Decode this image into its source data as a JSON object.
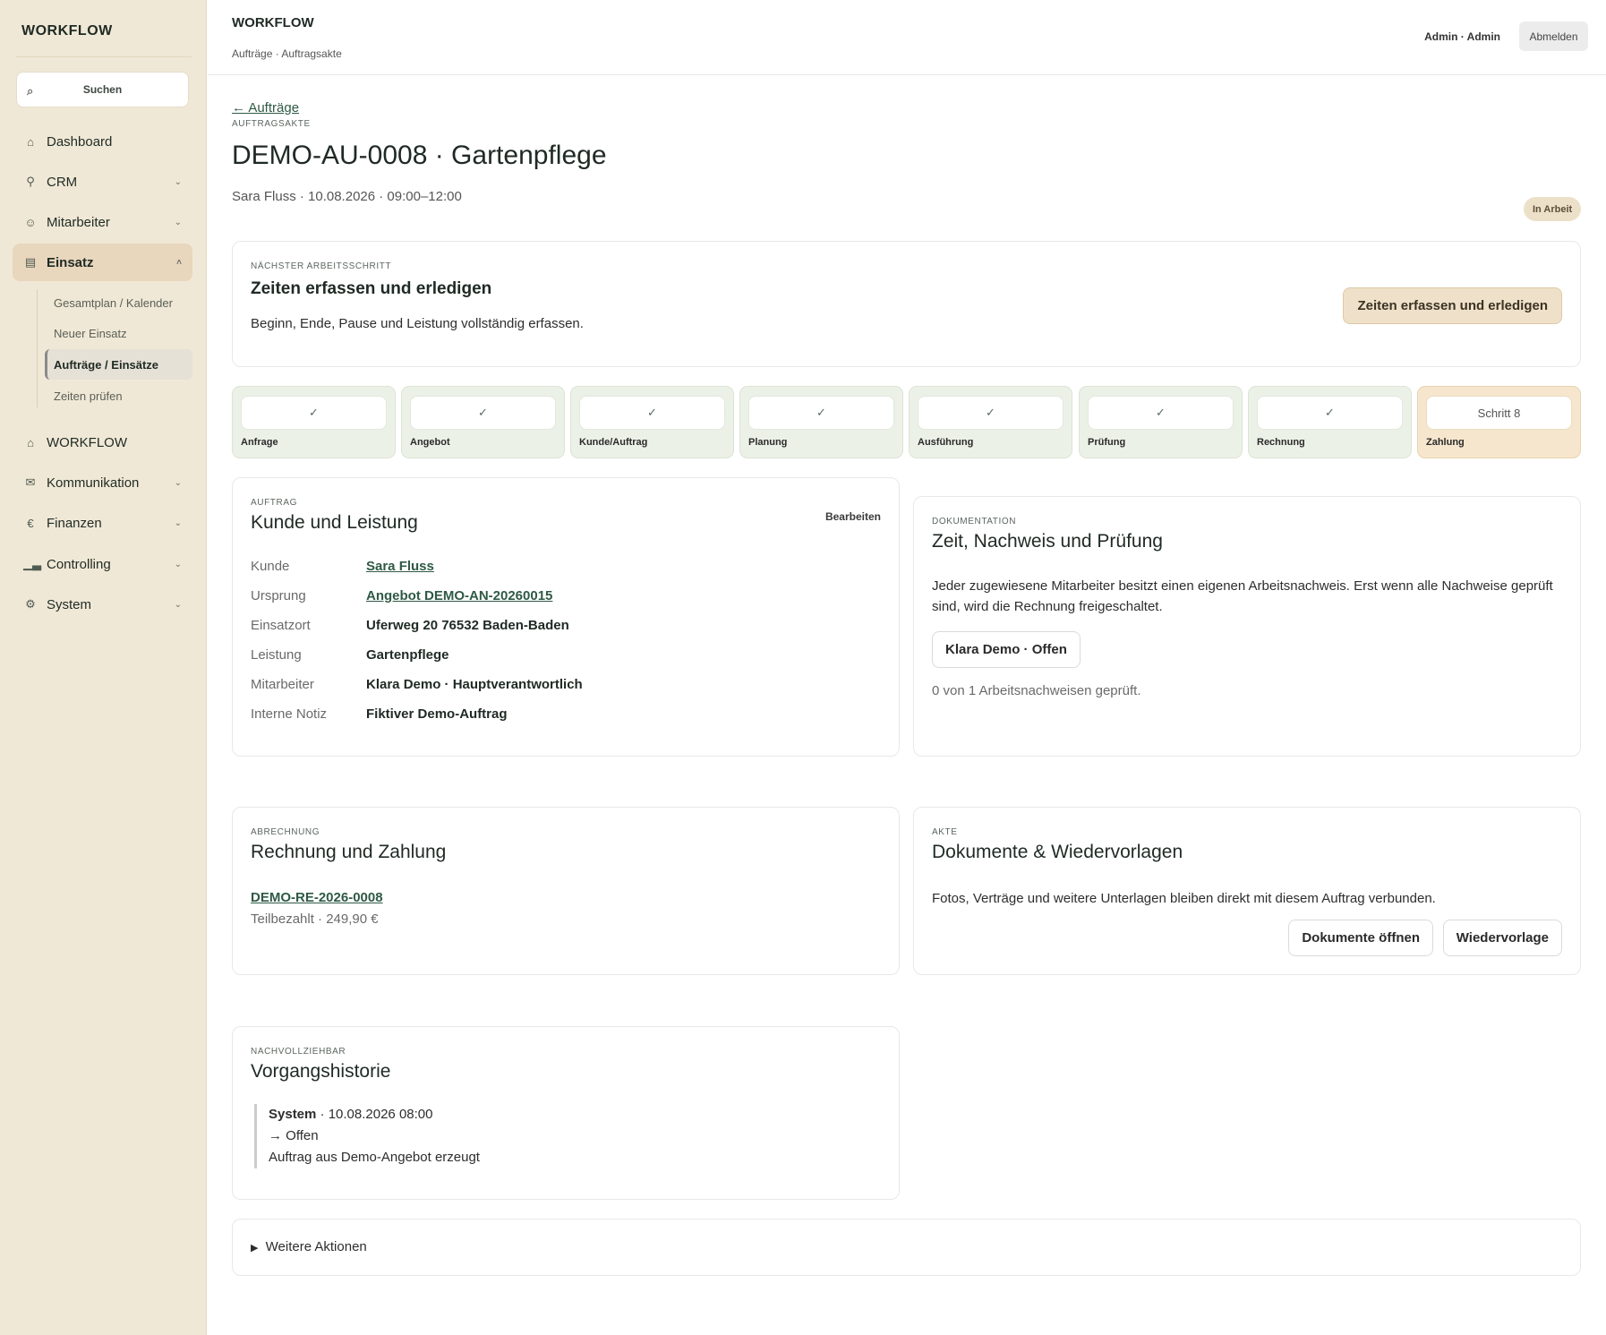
{
  "sidebar": {
    "brand": "WORKFLOW",
    "search_label": "Suchen",
    "search_icon": "⌕",
    "nav": [
      {
        "label": "Dashboard",
        "icon": "home-icon",
        "chevron": ""
      },
      {
        "label": "CRM",
        "icon": "users-icon",
        "chevron": "⌄"
      },
      {
        "label": "Mitarbeiter",
        "icon": "person-icon",
        "chevron": "⌄"
      },
      {
        "label": "Einsatz",
        "icon": "calendar-icon",
        "chevron": "˄"
      },
      {
        "label": "WORKFLOW",
        "icon": "home-icon",
        "chevron": ""
      },
      {
        "label": "Kommunikation",
        "icon": "mail-icon",
        "chevron": "⌄"
      },
      {
        "label": "Finanzen",
        "icon": "euro-icon",
        "chevron": "⌄"
      },
      {
        "label": "Controlling",
        "icon": "chart-icon",
        "chevron": "⌄"
      },
      {
        "label": "System",
        "icon": "gear-icon",
        "chevron": "⌄"
      }
    ],
    "sub": [
      "Gesamtplan / Kalender",
      "Neuer Einsatz",
      "Aufträge / Einsätze",
      "Zeiten prüfen"
    ]
  },
  "topbar": {
    "title": "WORKFLOW",
    "breadcrumb": "Aufträge · Auftragsakte",
    "user": "Admin · Admin",
    "logout": "Abmelden"
  },
  "page": {
    "back": "← Aufträge",
    "kicker": "AUFTRAGSAKTE",
    "title": "DEMO-AU-0008 · Gartenpflege",
    "meta": "Sara Fluss · 10.08.2026 · 09:00–12:00",
    "status": "In Arbeit"
  },
  "next_step": {
    "kicker": "NÄCHSTER ARBEITSSCHRITT",
    "title": "Zeiten erfassen und erledigen",
    "desc": "Beginn, Ende, Pause und Leistung vollständig erfassen.",
    "button": "Zeiten erfassen und erledigen"
  },
  "steps": [
    {
      "mark": "✓",
      "label": "Anfrage"
    },
    {
      "mark": "✓",
      "label": "Angebot"
    },
    {
      "mark": "✓",
      "label": "Kunde/Auftrag"
    },
    {
      "mark": "✓",
      "label": "Planung"
    },
    {
      "mark": "✓",
      "label": "Ausführung"
    },
    {
      "mark": "✓",
      "label": "Prüfung"
    },
    {
      "mark": "✓",
      "label": "Rechnung"
    },
    {
      "mark": "Schritt 8",
      "label": "Zahlung"
    }
  ],
  "order": {
    "kicker": "AUFTRAG",
    "title": "Kunde und Leistung",
    "edit": "Bearbeiten",
    "rows": [
      {
        "label": "Kunde",
        "value": "Sara Fluss"
      },
      {
        "label": "Ursprung",
        "value": "Angebot DEMO-AN-20260015"
      },
      {
        "label": "Einsatzort",
        "value": "Uferweg 20 76532 Baden-Baden"
      },
      {
        "label": "Leistung",
        "value": "Gartenpflege"
      },
      {
        "label": "Mitarbeiter",
        "value": "Klara Demo · Hauptverantwortlich"
      },
      {
        "label": "Interne Notiz",
        "value": "Fiktiver Demo-Auftrag"
      }
    ]
  },
  "doc": {
    "kicker": "DOKUMENTATION",
    "title": "Zeit, Nachweis und Prüfung",
    "text": "Jeder zugewiesene Mitarbeiter besitzt einen eigenen Arbeitsnachweis. Erst wenn alle Nachweise geprüft sind, wird die Rechnung freigeschaltet.",
    "chip": "Klara Demo · Offen",
    "summary": "0 von 1 Arbeitsnachweisen geprüft."
  },
  "billing": {
    "kicker": "ABRECHNUNG",
    "title": "Rechnung und Zahlung",
    "invoice": "DEMO-RE-2026-0008",
    "status": "Teilbezahlt · 249,90 €"
  },
  "files": {
    "kicker": "AKTE",
    "title": "Dokumente & Wiedervorlagen",
    "text": "Fotos, Verträge und weitere Unterlagen bleiben direkt mit diesem Auftrag verbunden.",
    "open": "Dokumente öffnen",
    "followup": "Wiedervorlage"
  },
  "history": {
    "kicker": "NACHVOLLZIEHBAR",
    "title": "Vorgangshistorie",
    "actor": "System",
    "time": " · 10.08.2026 08:00",
    "change": "→ Offen",
    "note": "Auftrag aus Demo-Angebot erzeugt"
  },
  "more": {
    "label": "Weitere Aktionen",
    "marker": "▶"
  }
}
